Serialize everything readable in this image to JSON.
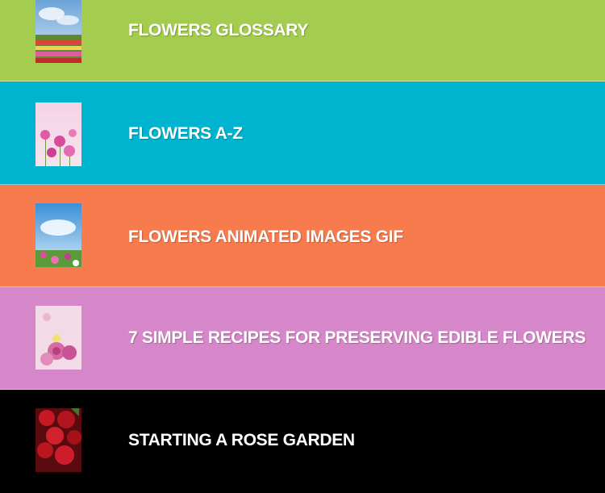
{
  "menu": {
    "items": [
      {
        "label": "FLOWERS GLOSSARY",
        "color": "#a4cc4e",
        "thumbnail": "field-of-tulips-thumbnail"
      },
      {
        "label": "FLOWERS A-Z",
        "color": "#00b4cf",
        "thumbnail": "pink-cosmos-thumbnail"
      },
      {
        "label": "FLOWERS ANIMATED IMAGES GIF",
        "color": "#f87b4d",
        "thumbnail": "sky-and-wildflowers-thumbnail"
      },
      {
        "label": "7 SIMPLE RECIPES FOR PRESERVING EDIBLE FLOWERS",
        "color": "#d687c9",
        "thumbnail": "pink-roses-butterfly-thumbnail"
      },
      {
        "label": "STARTING A ROSE GARDEN",
        "color": "#000000",
        "thumbnail": "red-roses-thumbnail"
      }
    ]
  }
}
